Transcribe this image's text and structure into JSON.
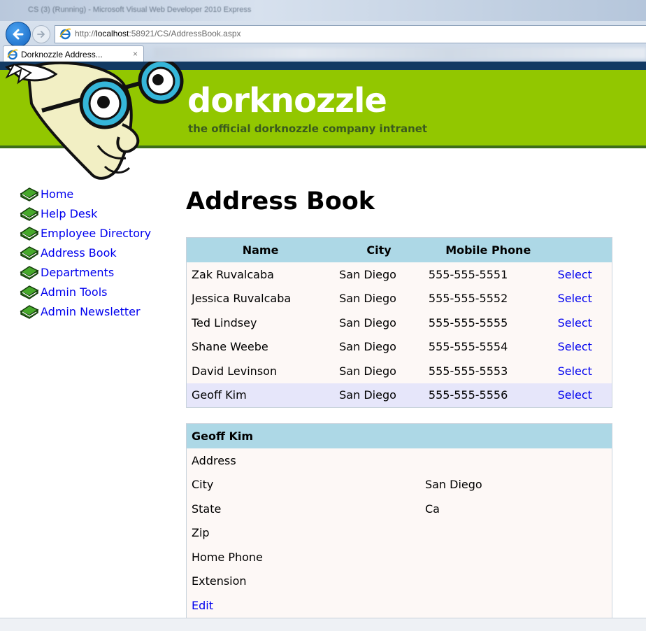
{
  "browser": {
    "window_title": "CS (3) (Running) - Microsoft Visual Web Developer 2010 Express",
    "url_prefix": "http://",
    "url_host": "localhost",
    "url_rest": ":58921/CS/AddressBook.aspx",
    "tab_title": "Dorknozzle Address...",
    "tab_close": "×"
  },
  "site": {
    "name": "dorknozzle",
    "tagline": "the official dorknozzle company intranet"
  },
  "sidebar": {
    "items": [
      {
        "label": "Home"
      },
      {
        "label": "Help Desk"
      },
      {
        "label": "Employee Directory"
      },
      {
        "label": "Address Book"
      },
      {
        "label": "Departments"
      },
      {
        "label": "Admin Tools"
      },
      {
        "label": "Admin Newsletter"
      }
    ]
  },
  "main": {
    "title": "Address Book",
    "grid": {
      "columns": [
        "Name",
        "City",
        "Mobile Phone"
      ],
      "select_label": "Select",
      "rows": [
        {
          "name": "Zak Ruvalcaba",
          "city": "San Diego",
          "phone": "555-555-5551"
        },
        {
          "name": "Jessica Ruvalcaba",
          "city": "San Diego",
          "phone": "555-555-5552"
        },
        {
          "name": "Ted Lindsey",
          "city": "San Diego",
          "phone": "555-555-5555"
        },
        {
          "name": "Shane Weebe",
          "city": "San Diego",
          "phone": "555-555-5554"
        },
        {
          "name": "David Levinson",
          "city": "San Diego",
          "phone": "555-555-5553"
        },
        {
          "name": "Geoff Kim",
          "city": "San Diego",
          "phone": "555-555-5556"
        }
      ],
      "selected_index": 5
    },
    "details": {
      "header": "Geoff Kim",
      "fields": [
        {
          "label": "Address",
          "value": ""
        },
        {
          "label": "City",
          "value": "San Diego"
        },
        {
          "label": "State",
          "value": "Ca"
        },
        {
          "label": "Zip",
          "value": ""
        },
        {
          "label": "Home Phone",
          "value": ""
        },
        {
          "label": "Extension",
          "value": ""
        }
      ],
      "edit_label": "Edit"
    }
  },
  "colors": {
    "banner_green": "#92c700",
    "header_blue": "#add8e6",
    "row_bg": "#fdf8f6",
    "selected_row_bg": "#e6e6fa",
    "link": "#0000ee"
  }
}
